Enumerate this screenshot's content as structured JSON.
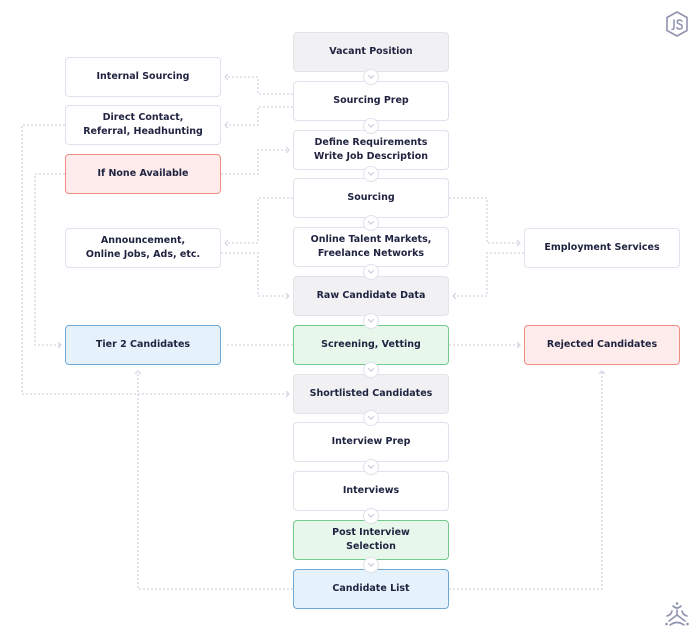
{
  "diagram": {
    "main_flow": [
      {
        "id": "vacant",
        "label": "Vacant Position",
        "style": "gray"
      },
      {
        "id": "sourcing-prep",
        "label": "Sourcing Prep",
        "style": "white"
      },
      {
        "id": "define-req",
        "label": "Define Requirements\nWrite Job Description",
        "style": "white"
      },
      {
        "id": "sourcing",
        "label": "Sourcing",
        "style": "white"
      },
      {
        "id": "online-talent",
        "label": "Online Talent Markets,\nFreelance Networks",
        "style": "white"
      },
      {
        "id": "raw-data",
        "label": "Raw Candidate Data",
        "style": "gray"
      },
      {
        "id": "screening",
        "label": "Screening, Vetting",
        "style": "green"
      },
      {
        "id": "shortlisted",
        "label": "Shortlisted Candidates",
        "style": "gray"
      },
      {
        "id": "interview-prep",
        "label": "Interview Prep",
        "style": "white"
      },
      {
        "id": "interviews",
        "label": "Interviews",
        "style": "white"
      },
      {
        "id": "post-interview",
        "label": "Post Interview\nSelection",
        "style": "green"
      },
      {
        "id": "candidate-list",
        "label": "Candidate List",
        "style": "blue"
      }
    ],
    "left_nodes": [
      {
        "id": "internal",
        "label": "Internal Sourcing",
        "style": "white"
      },
      {
        "id": "direct",
        "label": "Direct Contact,\nReferral, Headhunting",
        "style": "white"
      },
      {
        "id": "if-none",
        "label": "If None Available",
        "style": "red"
      },
      {
        "id": "announcement",
        "label": "Announcement,\nOnline Jobs, Ads, etc.",
        "style": "white"
      },
      {
        "id": "tier2",
        "label": "Tier 2 Candidates",
        "style": "blue"
      }
    ],
    "right_nodes": [
      {
        "id": "employment",
        "label": "Employment Services",
        "style": "white"
      },
      {
        "id": "rejected",
        "label": "Rejected Candidates",
        "style": "red"
      }
    ],
    "icons": {
      "top_right": "nodejs-logo-icon",
      "bottom_right": "tri-node-logo-icon",
      "connector": "chevron-down-icon"
    },
    "colors": {
      "text": "#1f2340",
      "border": "#dfe1ec",
      "gray_fill": "#f1f1f4",
      "red_fill": "#fdeceb",
      "red_border": "#ee8d82",
      "green_fill": "#e8f7ec",
      "green_border": "#72cb8d",
      "blue_fill": "#e6f2fb",
      "blue_border": "#6ea9d6",
      "line": "#d3d5e2",
      "logo": "#8f93ad"
    }
  }
}
